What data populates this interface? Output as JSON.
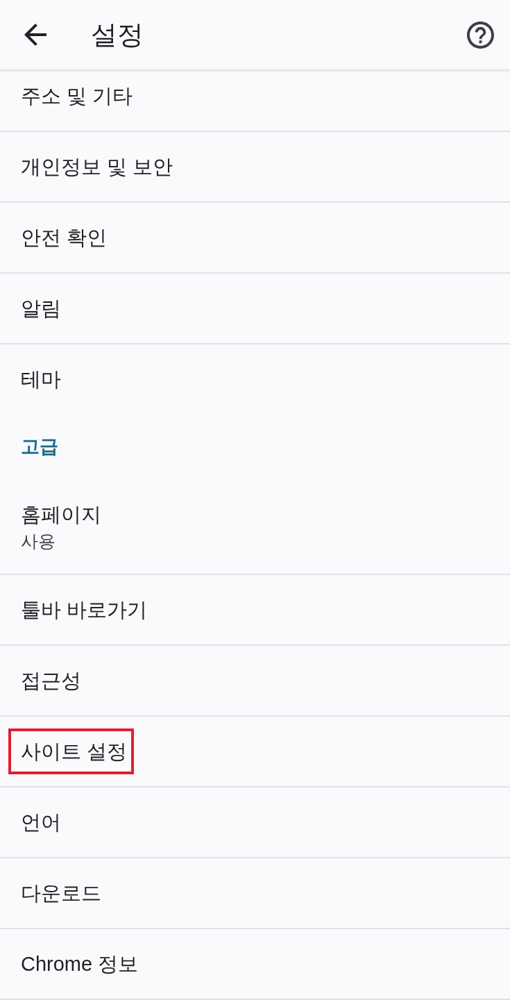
{
  "app_bar": {
    "title": "설정"
  },
  "items": [
    {
      "kind": "item",
      "label": "주소 및 기타",
      "highlighted": false
    },
    {
      "kind": "item",
      "label": "개인정보 및 보안",
      "highlighted": false
    },
    {
      "kind": "item",
      "label": "안전 확인",
      "highlighted": false
    },
    {
      "kind": "item",
      "label": "알림",
      "highlighted": false
    },
    {
      "kind": "item",
      "label": "테마",
      "highlighted": false
    },
    {
      "kind": "section",
      "label": "고급"
    },
    {
      "kind": "item",
      "label": "홈페이지",
      "summary": "사용",
      "highlighted": false
    },
    {
      "kind": "item",
      "label": "툴바 바로가기",
      "highlighted": false
    },
    {
      "kind": "item",
      "label": "접근성",
      "highlighted": false
    },
    {
      "kind": "item",
      "label": "사이트 설정",
      "highlighted": true
    },
    {
      "kind": "item",
      "label": "언어",
      "highlighted": false
    },
    {
      "kind": "item",
      "label": "다운로드",
      "highlighted": false
    },
    {
      "kind": "item",
      "label": "Chrome 정보",
      "highlighted": false
    }
  ]
}
